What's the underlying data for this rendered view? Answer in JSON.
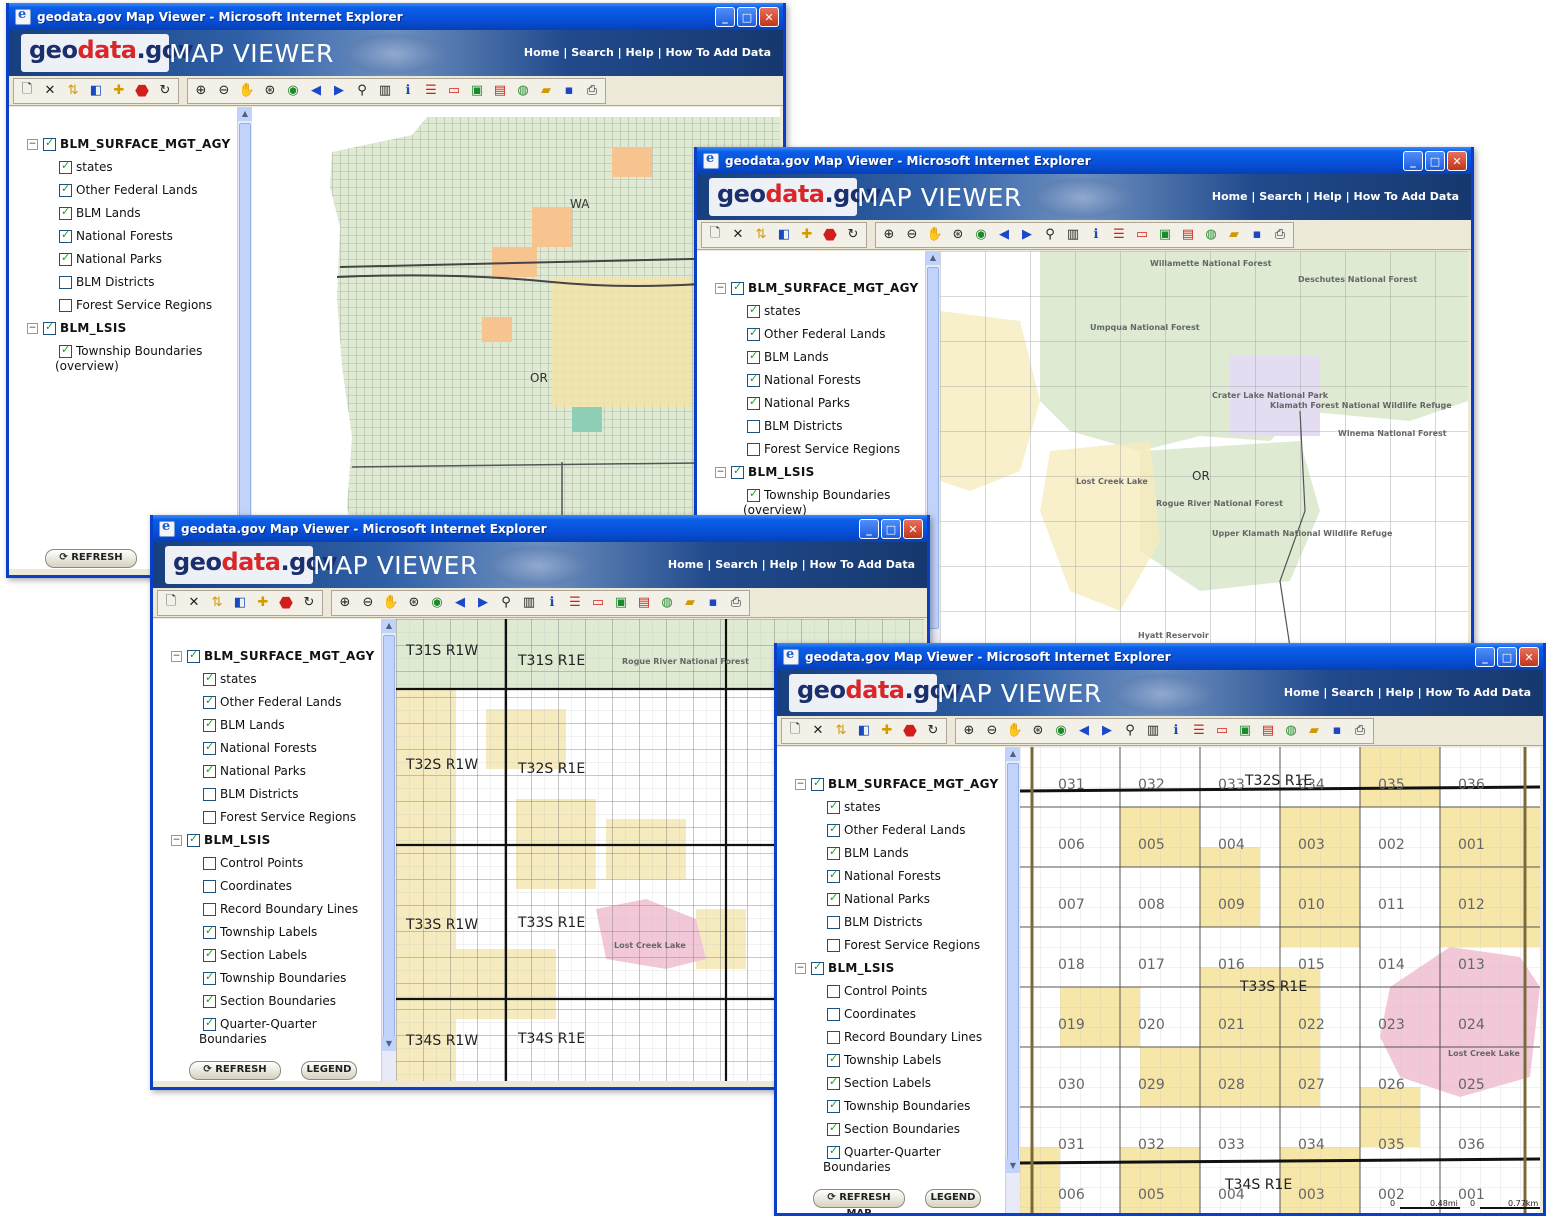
{
  "window_title": "geodata.gov Map Viewer - Microsoft Internet Explorer",
  "brand": {
    "geo": "geo",
    "data": "data",
    "gov": ".gov",
    "map_viewer": "MAP VIEWER"
  },
  "header_links": "Home | Search | Help | How To Add Data",
  "buttons": {
    "refresh": "REFRESH MAP",
    "legend": "LEGEND"
  },
  "layers_short": {
    "group1": "BLM_SURFACE_MGT_AGY",
    "group1_items": [
      {
        "label": "states",
        "checked": true
      },
      {
        "label": "Other Federal Lands",
        "checked": true
      },
      {
        "label": "BLM Lands",
        "checked": true
      },
      {
        "label": "National Forests",
        "checked": true
      },
      {
        "label": "National Parks",
        "checked": true
      },
      {
        "label": "BLM Districts",
        "checked": false
      },
      {
        "label": "Forest Service Regions",
        "checked": false
      }
    ],
    "group2": "BLM_LSIS",
    "group2_items": [
      {
        "label": "Township Boundaries",
        "sublabel": "(overview)",
        "checked": true
      }
    ]
  },
  "layers_long": {
    "group2_items": [
      {
        "label": "Control Points",
        "checked": false
      },
      {
        "label": "Coordinates",
        "checked": false
      },
      {
        "label": "Record Boundary Lines",
        "checked": false
      },
      {
        "label": "Township Labels",
        "checked": true
      },
      {
        "label": "Section Labels",
        "checked": true
      },
      {
        "label": "Township Boundaries",
        "checked": true
      },
      {
        "label": "Section Boundaries",
        "checked": true
      },
      {
        "label": "Quarter-Quarter",
        "sublabel": "Boundaries",
        "checked": true
      }
    ]
  },
  "map1": {
    "labels": [
      "WA",
      "OR"
    ]
  },
  "map2": {
    "labels": {
      "willamette": "Willamette National Forest",
      "deschutes": "Deschutes National Forest",
      "umpqua": "Umpqua National Forest",
      "crater": "Crater Lake National Park",
      "klamath_refuge": "Klamath Forest National Wildlife Refuge",
      "winema": "Winema National Forest",
      "or": "OR",
      "lost_creek": "Lost Creek Lake",
      "rogue": "Rogue River National Forest",
      "upper_klamath": "Upper Klamath National Wildlife Refuge",
      "hyatt": "Hyatt Reservoir"
    }
  },
  "map3": {
    "labels": {
      "t31s_r1w": "T31S R1W",
      "t31s_r1e": "T31S R1E",
      "rogue": "Rogue River National Forest",
      "t32s_r1w": "T32S R1W",
      "t32s_r1e": "T32S R1E",
      "t33s_r1w": "T33S R1W",
      "t33s_r1e": "T33S R1E",
      "lost_creek": "Lost Creek Lake",
      "t34s_r1w": "T34S R1W",
      "t34s_r1e": "T34S R1E"
    }
  },
  "map4": {
    "rows": [
      [
        "031",
        "032",
        "033",
        "034",
        "035",
        "036"
      ],
      [
        "006",
        "005",
        "004",
        "003",
        "002",
        "001"
      ],
      [
        "007",
        "008",
        "009",
        "010",
        "011",
        "012"
      ],
      [
        "018",
        "017",
        "016",
        "015",
        "014",
        "013"
      ],
      [
        "019",
        "020",
        "021",
        "022",
        "023",
        "024"
      ],
      [
        "030",
        "029",
        "028",
        "027",
        "026",
        "025"
      ],
      [
        "031",
        "032",
        "033",
        "034",
        "035",
        "036"
      ],
      [
        "006",
        "005",
        "004",
        "003",
        "002",
        "001"
      ]
    ],
    "township_top": "T32S R1E",
    "township_mid": "T33S R1E",
    "township_bottom": "T34S R1E",
    "lost_creek": "Lost Creek Lake",
    "scale_mi": "0.48mi",
    "scale_km": "0.77km",
    "scale_zero": "0"
  }
}
